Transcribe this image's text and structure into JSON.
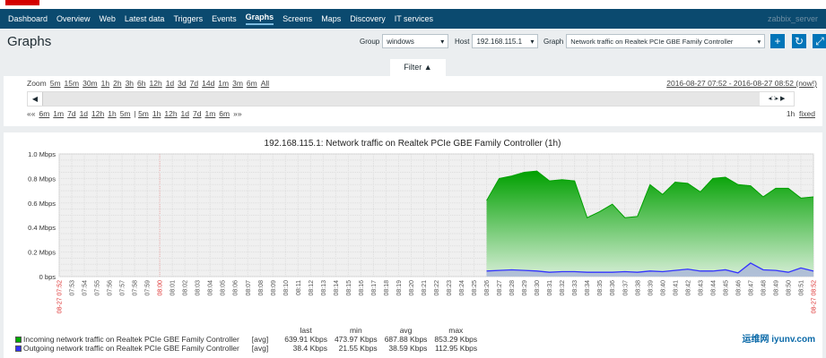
{
  "nav": {
    "items": [
      "Dashboard",
      "Overview",
      "Web",
      "Latest data",
      "Triggers",
      "Events",
      "Graphs",
      "Screens",
      "Maps",
      "Discovery",
      "IT services"
    ],
    "active": "Graphs",
    "user": "zabbix_server"
  },
  "page": {
    "title": "Graphs"
  },
  "controls": {
    "group_label": "Group",
    "group_value": "windows",
    "host_label": "Host",
    "host_value": "192.168.115.1",
    "graph_label": "Graph",
    "graph_value": "Network traffic on Realtek PCIe GBE Family Controller"
  },
  "filter": {
    "tab_label": "Filter ▲",
    "zoom_label": "Zoom",
    "zoom_options": [
      "5m",
      "15m",
      "30m",
      "1h",
      "2h",
      "3h",
      "6h",
      "12h",
      "1d",
      "3d",
      "7d",
      "14d",
      "1m",
      "3m",
      "6m",
      "All"
    ],
    "range": "2016-08-27 07:52 - 2016-08-27 08:52 (now!)",
    "back_label": "««",
    "back_options": [
      "6m",
      "1m",
      "7d",
      "1d",
      "12h",
      "1h",
      "5m"
    ],
    "fwd_options": [
      "5m",
      "1h",
      "12h",
      "1d",
      "7d",
      "1m",
      "6m"
    ],
    "fwd_label": "»»",
    "period": "1h",
    "fixed": "fixed"
  },
  "chart_data": {
    "type": "area",
    "title": "192.168.115.1: Network traffic on Realtek PCIe GBE Family Controller (1h)",
    "yticks": [
      "0 bps",
      "0.2 Mbps",
      "0.4 Mbps",
      "0.6 Mbps",
      "0.8 Mbps",
      "1.0 Mbps"
    ],
    "ylim": [
      0,
      1.0
    ],
    "yunit": "Mbps",
    "xstart": "08-27 07:52",
    "xend": "08-27 08:52",
    "grid": true,
    "x": [
      "08:26",
      "08:27",
      "08:28",
      "08:29",
      "08:30",
      "08:31",
      "08:32",
      "08:33",
      "08:34",
      "08:35",
      "08:36",
      "08:37",
      "08:38",
      "08:39",
      "08:40",
      "08:41",
      "08:42",
      "08:43",
      "08:44",
      "08:45",
      "08:46",
      "08:47",
      "08:48",
      "08:49",
      "08:50",
      "08:51",
      "08:52"
    ],
    "series": [
      {
        "name": "Incoming network traffic on Realtek PCIe GBE Family Controller",
        "color": "#00aa00",
        "values": [
          0.62,
          0.8,
          0.82,
          0.85,
          0.86,
          0.78,
          0.79,
          0.78,
          0.48,
          0.53,
          0.59,
          0.48,
          0.49,
          0.75,
          0.67,
          0.77,
          0.76,
          0.69,
          0.8,
          0.81,
          0.75,
          0.74,
          0.65,
          0.72,
          0.72,
          0.64,
          0.65
        ],
        "func": "[avg]",
        "last": "639.91 Kbps",
        "min": "473.97 Kbps",
        "avg": "687.88 Kbps",
        "max": "853.29 Kbps"
      },
      {
        "name": "Outgoing network traffic on Realtek PCIe GBE Family Controller",
        "color": "#3333ff",
        "values": [
          0.045,
          0.05,
          0.055,
          0.05,
          0.045,
          0.035,
          0.04,
          0.04,
          0.035,
          0.035,
          0.035,
          0.04,
          0.035,
          0.045,
          0.04,
          0.05,
          0.06,
          0.045,
          0.045,
          0.055,
          0.03,
          0.11,
          0.055,
          0.05,
          0.035,
          0.07,
          0.045
        ],
        "func": "[avg]",
        "last": "38.4 Kbps",
        "min": "21.55 Kbps",
        "avg": "38.59 Kbps",
        "max": "112.95 Kbps"
      }
    ],
    "legend_headers": [
      "last",
      "min",
      "avg",
      "max"
    ]
  },
  "watermark": "运维网 iyunv.com"
}
